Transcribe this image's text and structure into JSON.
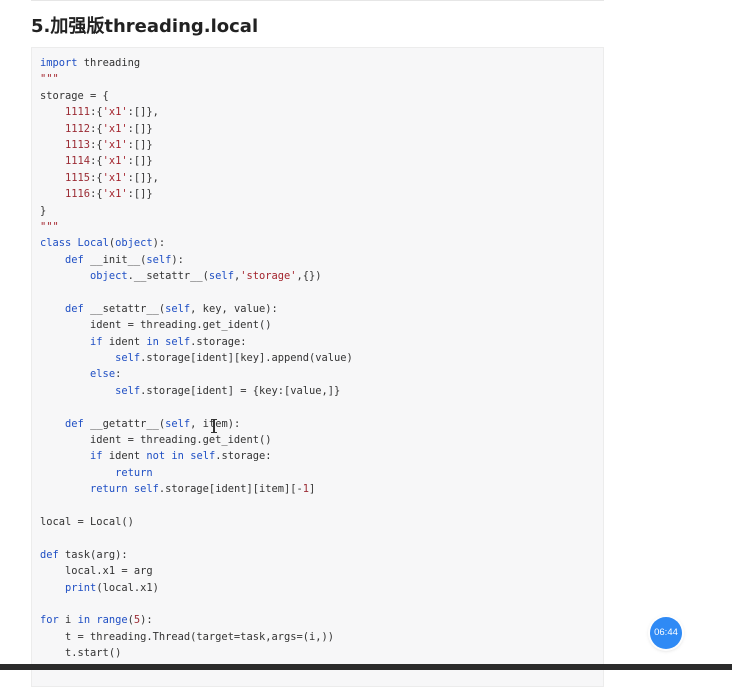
{
  "section": {
    "heading": "5.加强版threading.local"
  },
  "timer": {
    "label": "06:44"
  },
  "code": {
    "language": "python",
    "lines": [
      "import threading",
      "\"\"\"",
      "storage = {",
      "    1111:{'x1':[]},",
      "    1112:{'x1':[]}",
      "    1113:{'x1':[]}",
      "    1114:{'x1':[]}",
      "    1115:{'x1':[]},",
      "    1116:{'x1':[]}",
      "}",
      "\"\"\"",
      "class Local(object):",
      "    def __init__(self):",
      "        object.__setattr__(self,'storage',{})",
      "",
      "    def __setattr__(self, key, value):",
      "        ident = threading.get_ident()",
      "        if ident in self.storage:",
      "            self.storage[ident][key].append(value)",
      "        else:",
      "            self.storage[ident] = {key:[value,]}",
      "",
      "    def __getattr__(self, item):",
      "        ident = threading.get_ident()",
      "        if ident not in self.storage:",
      "            return",
      "        return self.storage[ident][item][-1]",
      "",
      "local = Local()",
      "",
      "def task(arg):",
      "    local.x1 = arg",
      "    print(local.x1)",
      "",
      "for i in range(5):",
      "    t = threading.Thread(target=task,args=(i,))",
      "    t.start()"
    ]
  }
}
